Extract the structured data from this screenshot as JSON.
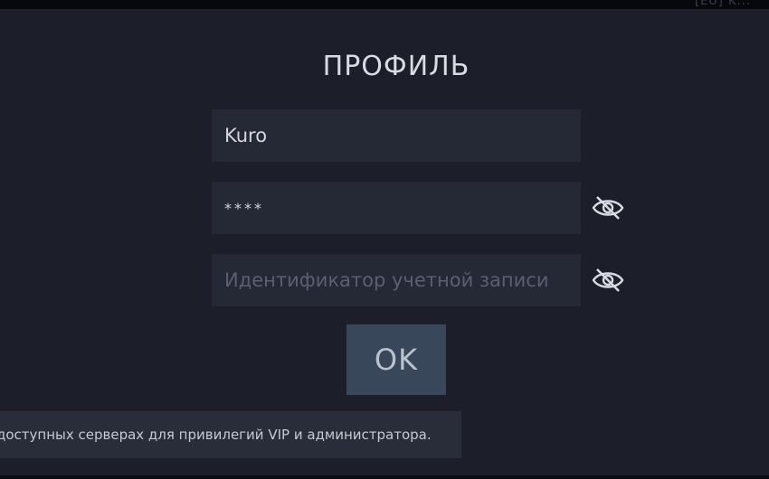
{
  "window": {
    "corner_tag": "[EU] K..."
  },
  "profile": {
    "title": "ПРОФИЛЬ",
    "username": {
      "value": "Kuro"
    },
    "password": {
      "value": "****"
    },
    "account_id": {
      "value": "",
      "placeholder": "Идентификатор учетной записи"
    },
    "toggle_icons": [
      "eye-slash-icon",
      "eye-slash-icon"
    ],
    "ok_label": "OK"
  },
  "notice": {
    "text": "доступных серверах для привилегий VIP и администратора."
  },
  "colors": {
    "background": "#1c1e29",
    "field": "#252835",
    "button": "#38475a",
    "text": "#d4d6de",
    "placeholder": "#5c5f6d"
  }
}
